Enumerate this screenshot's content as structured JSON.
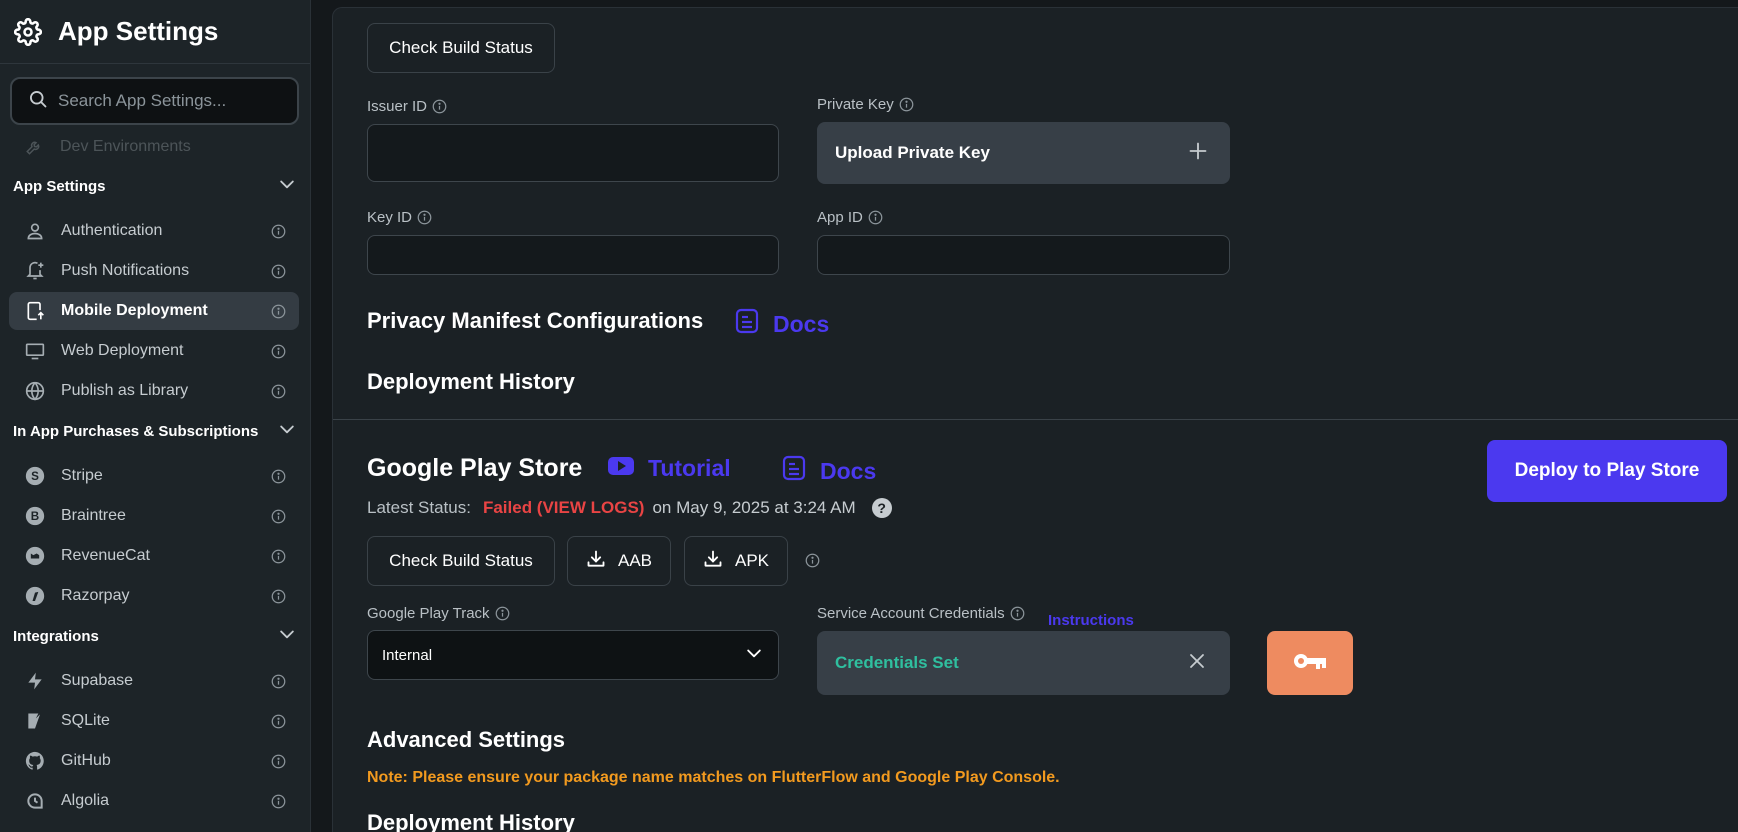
{
  "sidebar": {
    "title": "App Settings",
    "search_placeholder": "Search App Settings...",
    "partial_item": "Dev Environments",
    "sections": [
      {
        "label": "App Settings",
        "items": [
          {
            "label": "Authentication",
            "icon": "person-icon",
            "active": false
          },
          {
            "label": "Push Notifications",
            "icon": "bell-plus-icon",
            "active": false
          },
          {
            "label": "Mobile Deployment",
            "icon": "mobile-deploy-icon",
            "active": true
          },
          {
            "label": "Web Deployment",
            "icon": "monitor-icon",
            "active": false
          },
          {
            "label": "Publish as Library",
            "icon": "globe-icon",
            "active": false
          }
        ]
      },
      {
        "label": "In App Purchases & Subscriptions",
        "items": [
          {
            "label": "Stripe",
            "icon": "stripe-icon",
            "active": false
          },
          {
            "label": "Braintree",
            "icon": "braintree-icon",
            "active": false
          },
          {
            "label": "RevenueCat",
            "icon": "revenuecat-icon",
            "active": false
          },
          {
            "label": "Razorpay",
            "icon": "razorpay-icon",
            "active": false
          }
        ]
      },
      {
        "label": "Integrations",
        "items": [
          {
            "label": "Supabase",
            "icon": "supabase-icon",
            "active": false
          },
          {
            "label": "SQLite",
            "icon": "sqlite-icon",
            "active": false
          },
          {
            "label": "GitHub",
            "icon": "github-icon",
            "active": false
          },
          {
            "label": "Algolia",
            "icon": "algolia-icon",
            "active": false
          }
        ]
      }
    ]
  },
  "apple": {
    "check_build_label": "Check Build Status",
    "issuer_id_label": "Issuer ID",
    "issuer_id_value": "",
    "private_key_label": "Private Key",
    "upload_private_key_label": "Upload Private Key",
    "key_id_label": "Key ID",
    "key_id_value": "",
    "app_id_label": "App ID",
    "app_id_value": "",
    "privacy_manifest_title": "Privacy Manifest Configurations",
    "docs_label": "Docs",
    "deployment_history_title": "Deployment History"
  },
  "play": {
    "title": "Google Play Store",
    "tutorial_label": "Tutorial",
    "docs_label": "Docs",
    "deploy_button_label": "Deploy to Play Store",
    "latest_status_label": "Latest Status:",
    "status_value": "Failed (VIEW LOGS)",
    "status_date": "on May 9, 2025 at 3:24 AM",
    "check_build_label": "Check Build Status",
    "aab_label": "AAB",
    "apk_label": "APK",
    "track_label": "Google Play Track",
    "track_value": "Internal",
    "service_account_label": "Service Account Credentials",
    "instructions_label": "Instructions",
    "credentials_value": "Credentials Set",
    "advanced_settings_title": "Advanced Settings",
    "note": "Note: Please ensure your package name matches on FlutterFlow and Google Play Console.",
    "deployment_history_title": "Deployment History"
  },
  "colors": {
    "accent": "#4b39ef",
    "error": "#e94444",
    "success": "#2fbf9f",
    "warning": "#f29a1f",
    "key_button": "#ee8b60"
  }
}
